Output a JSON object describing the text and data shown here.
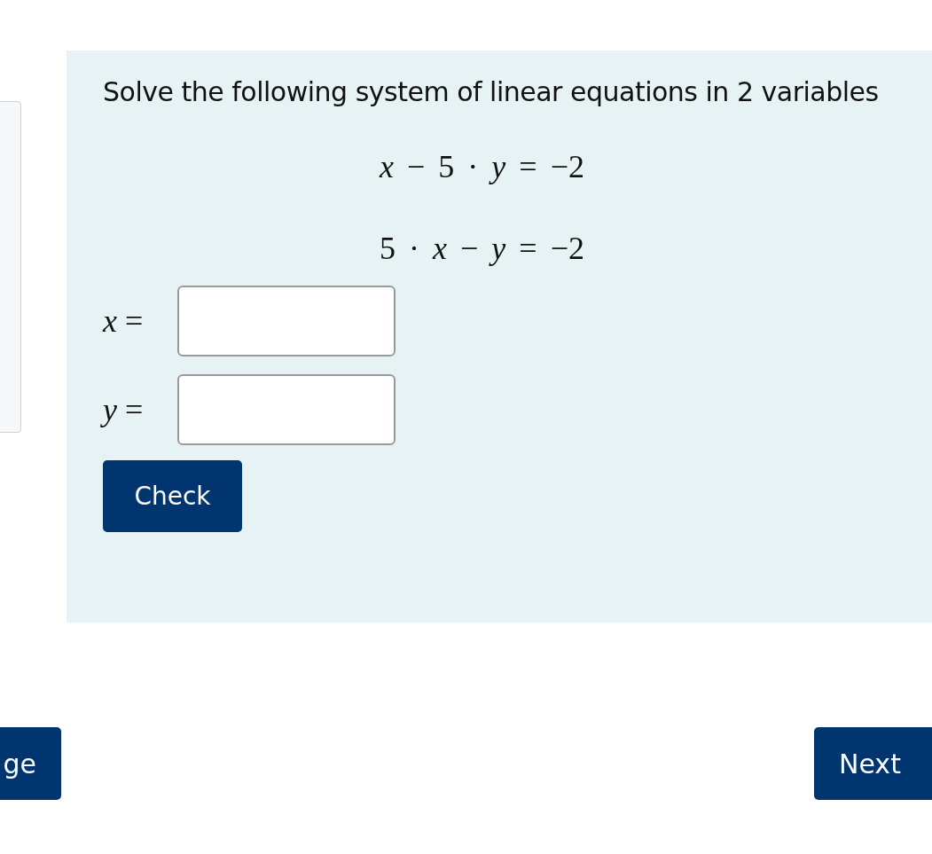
{
  "question": {
    "prompt": "Solve the following system of linear equations in 2 variables",
    "equations": [
      "*x* − 5 · *y* = −2",
      "5 · *x* − *y* = −2"
    ],
    "fields": [
      {
        "label": "*x* ="
      },
      {
        "label": "*y* ="
      }
    ],
    "check_button": "Check"
  },
  "navigation": {
    "previous": "ge",
    "next": "Next"
  }
}
